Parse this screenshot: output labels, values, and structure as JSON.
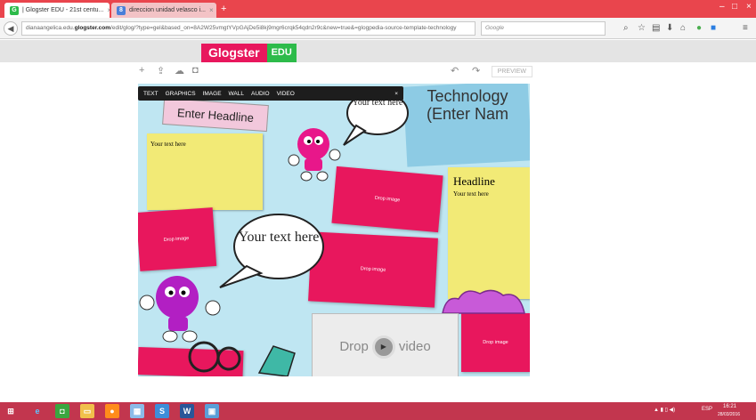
{
  "browser": {
    "tabs": [
      {
        "label": "| Glogster EDU - 21st centu...",
        "close": "×"
      },
      {
        "label": "direccion unidad velasco i...",
        "close": "×"
      }
    ],
    "new_tab": "+",
    "window_controls": {
      "minimize": "–",
      "maximize": "□",
      "close": "×"
    },
    "url_prefix": "dianaangelica.edu.",
    "url_domain": "glogster.com",
    "url_rest": "/edit/glog/?type=gel&based_on=8A2W25vmgtYVpGAjDe5i8kj9mgr6crqk54qdn2r9c&new=true&=glogpedia-source-template-technology",
    "search_engine": "Google",
    "colors": {
      "tab_strip": "#e9454d",
      "taskbar": "#c2364e"
    }
  },
  "glogster": {
    "logo_main": "Glogster",
    "logo_edu": "EDU",
    "edit_tools": [
      "+",
      "⇪",
      "☁",
      "◘"
    ],
    "undo": "↶",
    "redo": "↷",
    "preview": "PREVIEW",
    "colors": {
      "brand_pink": "#e8175d",
      "edu_green": "#2dbb4a"
    }
  },
  "canvas": {
    "toolbar": [
      "TEXT",
      "GRAPHICS",
      "IMAGE",
      "WALL",
      "AUDIO",
      "VIDEO"
    ],
    "toolbar_close": "×",
    "headline_tag": "Enter Headline",
    "bubble_small": "Your text here",
    "bubble_large": "Your text here",
    "tech_title": "Technology (Enter Nam",
    "sticky_left_text": "Your text here",
    "sticky_right_headline": "Headline",
    "sticky_right_text": "Your text here",
    "drop_image": "Drop image",
    "drop_video_left": "Drop",
    "drop_video_right": "video"
  },
  "taskbar": {
    "tray_lang": "ESP",
    "tray_time": "16:21",
    "tray_date": "28/03/2016"
  }
}
